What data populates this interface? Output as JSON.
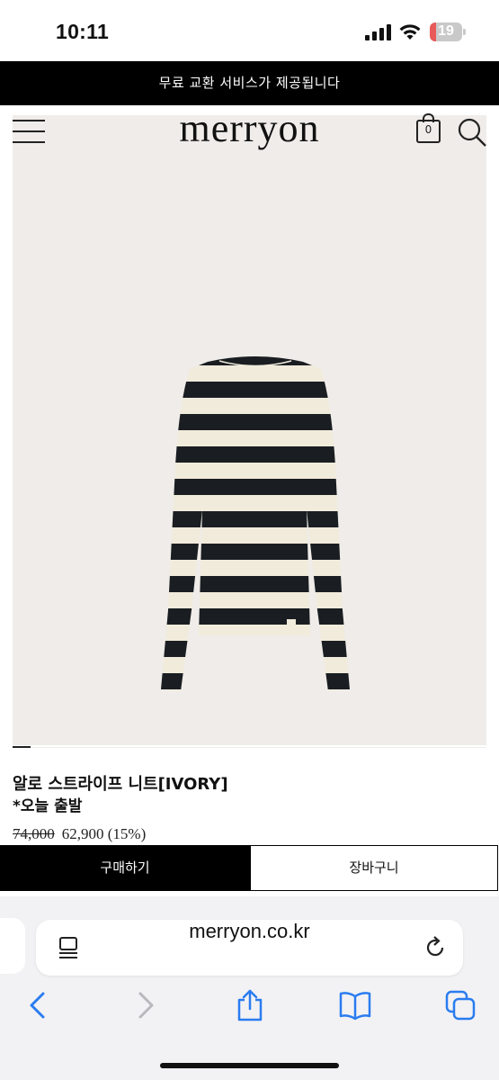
{
  "status_bar": {
    "time": "10:11",
    "battery": "19",
    "battery_level_percent": 19
  },
  "promo": {
    "text": "무료 교환 서비스가 제공됩니다"
  },
  "header": {
    "logo": "merryon",
    "cart_count": "0"
  },
  "product": {
    "name": "알로 스트라이프 니트[IVORY]",
    "note": "*오늘 출발",
    "original_price": "74,000",
    "sale_price": "62,900 (15%)"
  },
  "actions": {
    "buy_label": "구매하기",
    "cart_label": "장바구니"
  },
  "browser": {
    "url": "merryon.co.kr"
  },
  "colors": {
    "accent": "#000000",
    "hero_bg": "#efece9",
    "stripe_dark": "#1a1e22",
    "stripe_light": "#f1ebdc"
  }
}
